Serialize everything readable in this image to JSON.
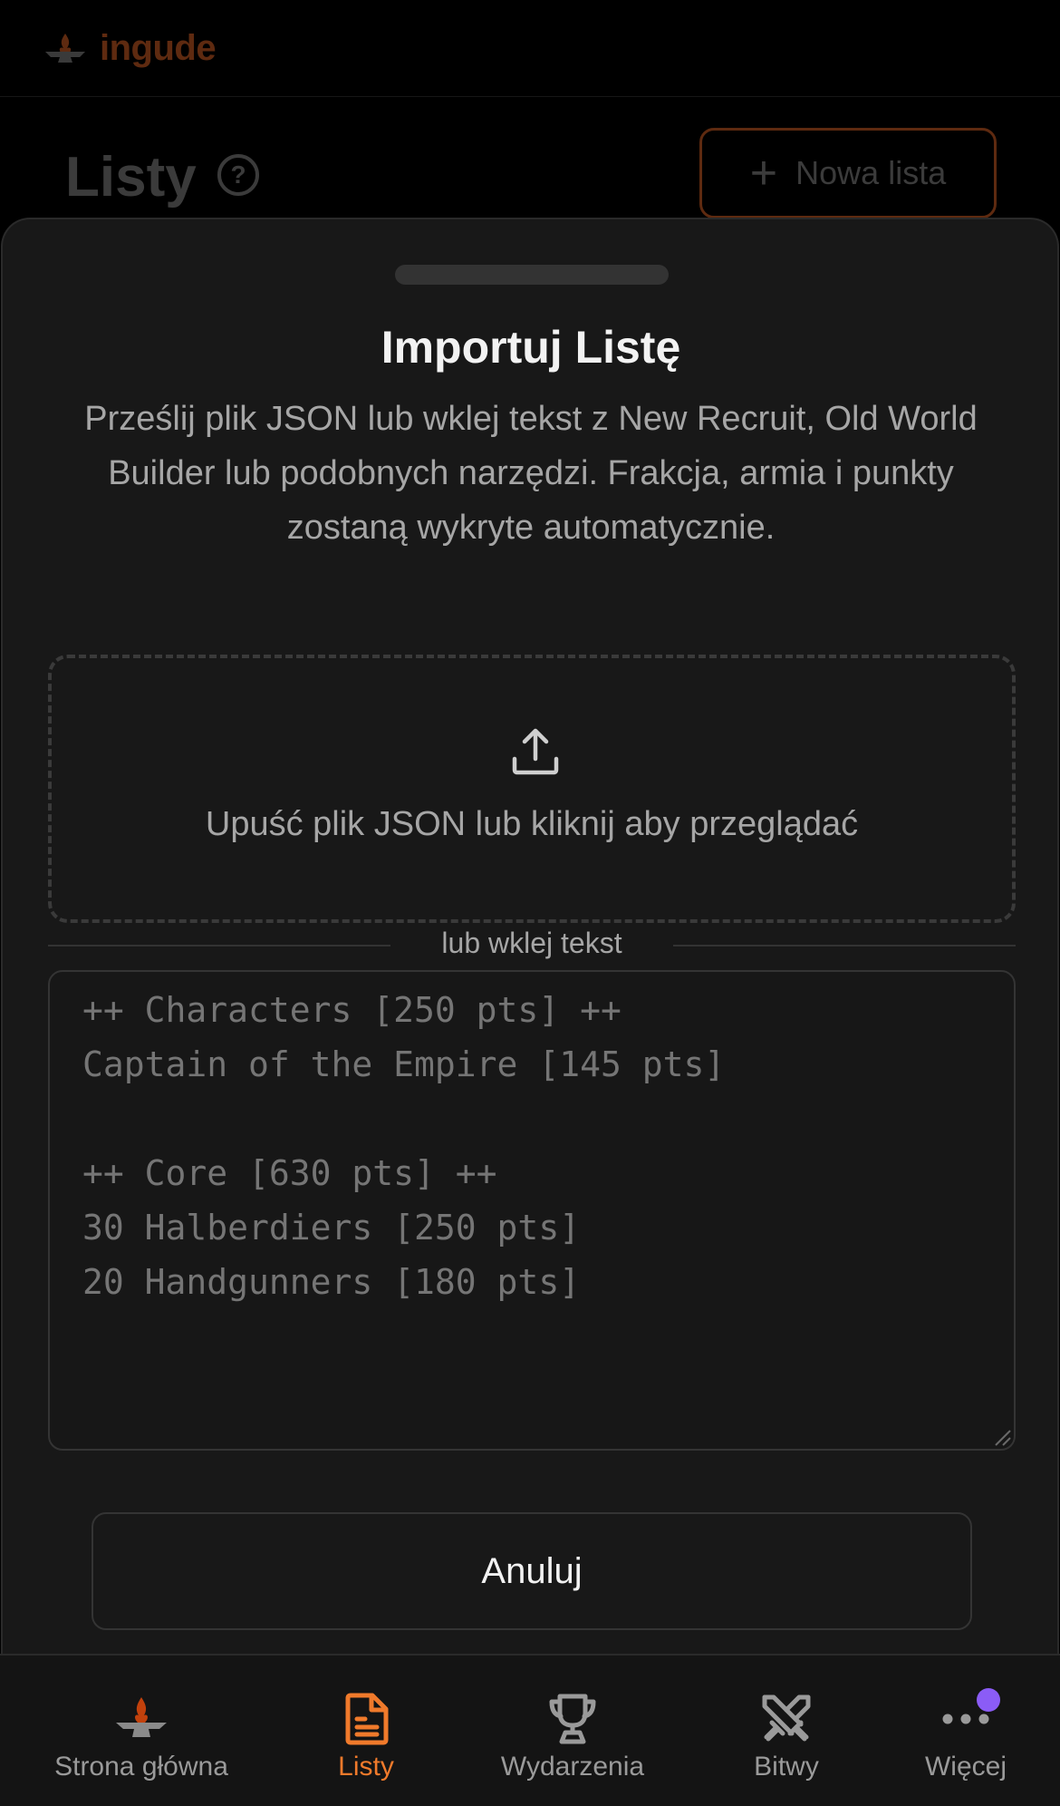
{
  "header": {
    "brand_name": "ingude",
    "brand_color": "#5e2a10"
  },
  "page": {
    "title": "Listy",
    "help_icon": "question-circle-icon",
    "new_list_label": "Nowa lista"
  },
  "modal": {
    "title": "Importuj Listę",
    "description": "Prześlij plik JSON lub wklej tekst z New Recruit, Old World Builder lub podobnych narzędzi. Frakcja, armia i punkty zostaną wykryte automatycznie.",
    "dropzone_text": "Upuść plik JSON lub kliknij aby przeglądać",
    "divider_text": "lub wklej tekst",
    "paste_placeholder": "++ Characters [250 pts] ++\nCaptain of the Empire [145 pts]\n\n++ Core [630 pts] ++\n30 Halberdiers [250 pts]\n20 Handgunners [180 pts]",
    "cancel_label": "Anuluj"
  },
  "nav": {
    "items": [
      {
        "label": "Strona główna",
        "icon": "anvil-flame-icon",
        "active": false
      },
      {
        "label": "Listy",
        "icon": "document-icon",
        "active": true
      },
      {
        "label": "Wydarzenia",
        "icon": "trophy-icon",
        "active": false
      },
      {
        "label": "Bitwy",
        "icon": "crossed-swords-icon",
        "active": false
      },
      {
        "label": "Więcej",
        "icon": "more-dots-icon",
        "active": false
      }
    ],
    "accent_color": "#f07a2b",
    "badge_color": "#8b5cf6"
  }
}
